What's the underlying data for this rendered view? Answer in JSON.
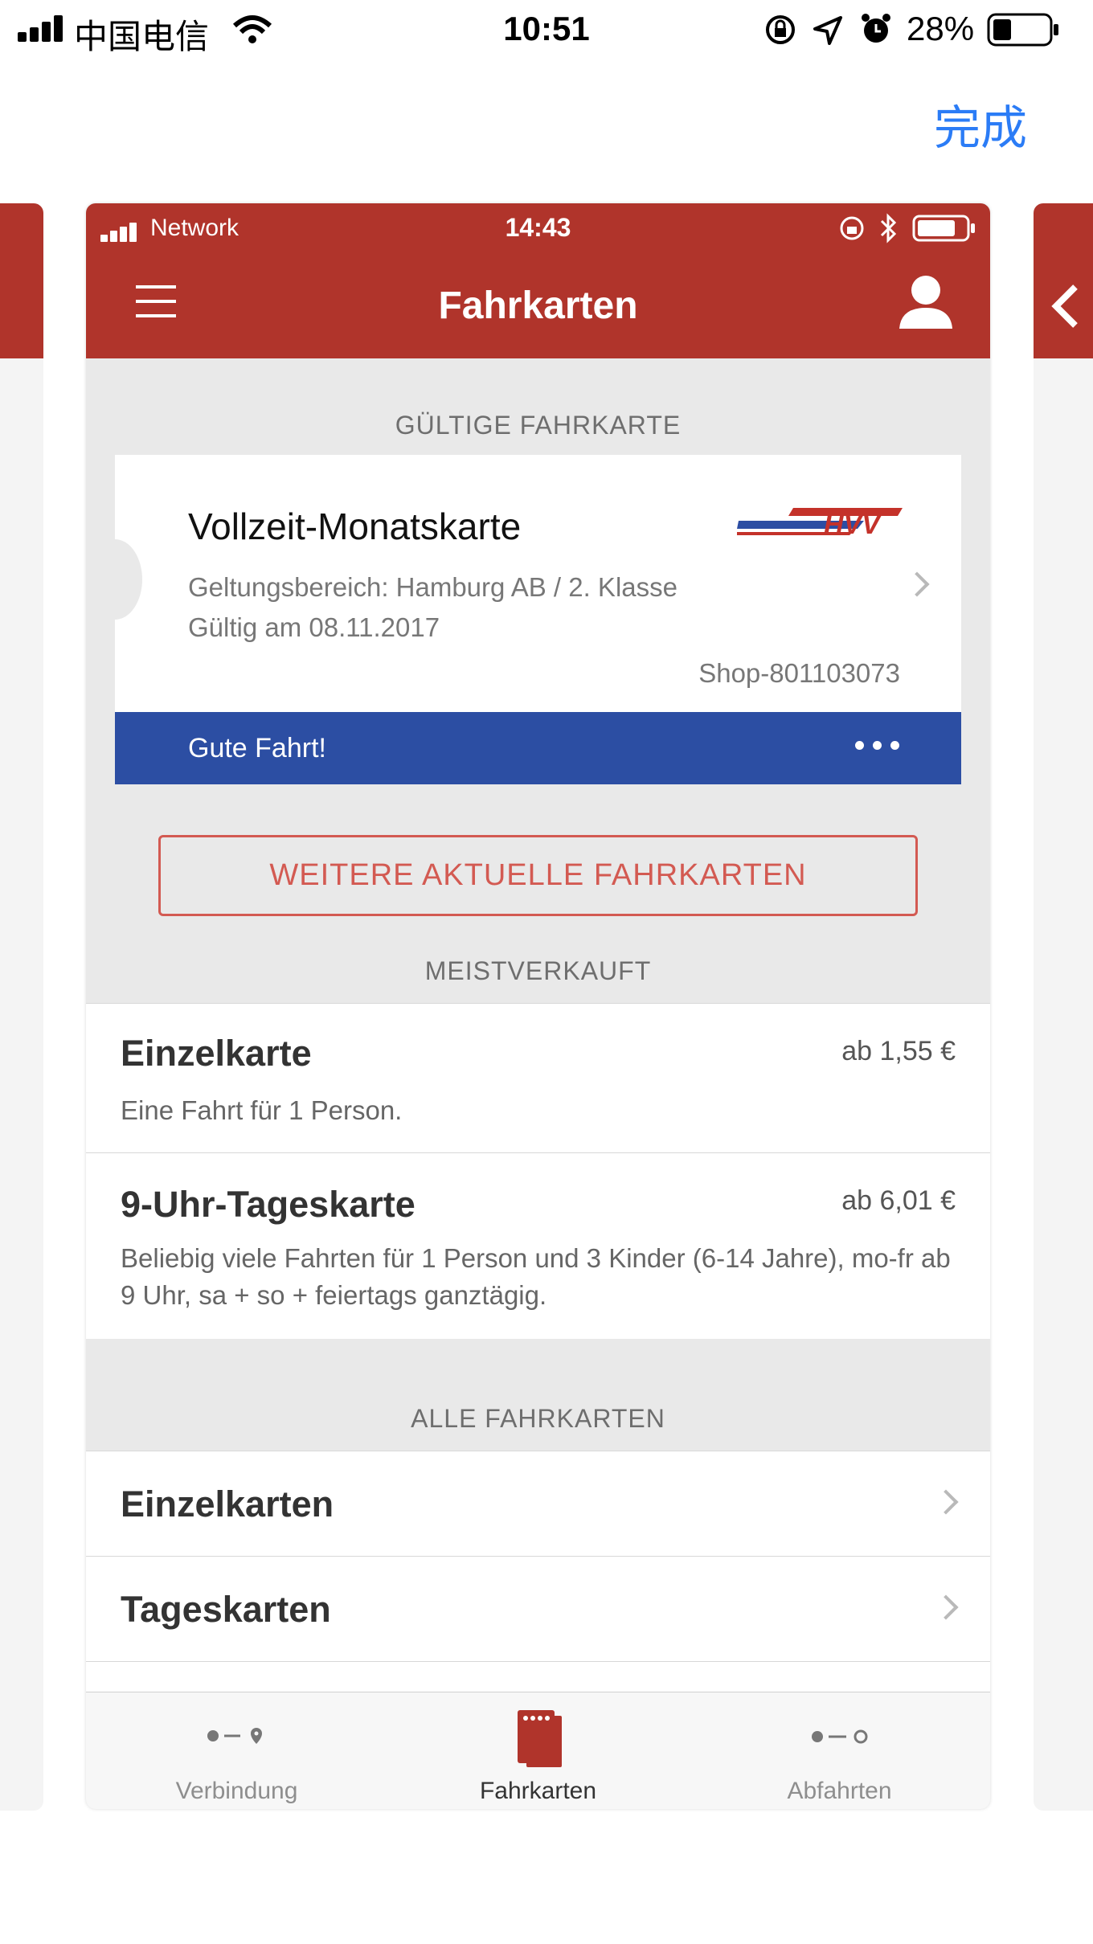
{
  "os_status": {
    "carrier": "中国电信",
    "time": "10:51",
    "battery": "28%"
  },
  "done_label": "完成",
  "app": {
    "status": {
      "network": "Network",
      "time": "14:43"
    },
    "header": {
      "title": "Fahrkarten"
    },
    "valid_section": {
      "label": "GÜLTIGE FAHRKARTE",
      "ticket": {
        "name": "Vollzeit-Monatskarte",
        "logo_text": "HVV",
        "scope": "Geltungsbereich: Hamburg AB / 2. Klasse",
        "valid": "Gültig am 08.11.2017",
        "shop": "Shop-801103073",
        "footer_text": "Gute Fahrt!"
      },
      "more_button": "WEITERE AKTUELLE FAHRKARTEN"
    },
    "bestseller": {
      "label": "MEISTVERKAUFT",
      "items": [
        {
          "title": "Einzelkarte",
          "price": "ab 1,55 €",
          "desc": "Eine Fahrt für 1 Person."
        },
        {
          "title": "9-Uhr-Tageskarte",
          "price": "ab 6,01 €",
          "desc": "Beliebig viele Fahrten für 1 Person und 3 Kinder (6-14 Jahre), mo-fr ab 9 Uhr, sa + so + feiertags ganztägig."
        }
      ]
    },
    "all_tickets": {
      "label": "ALLE FAHRKARTEN",
      "items": [
        {
          "title": "Einzelkarten"
        },
        {
          "title": "Tageskarten"
        }
      ]
    },
    "tabs": [
      {
        "label": "Verbindung",
        "icon": "route-icon"
      },
      {
        "label": "Fahrkarten",
        "icon": "tickets-icon"
      },
      {
        "label": "Abfahrten",
        "icon": "departures-icon"
      }
    ]
  },
  "colors": {
    "brand_red": "#b0342b",
    "ticket_blue": "#2c4ea3",
    "ios_blue": "#2b7cf6"
  }
}
